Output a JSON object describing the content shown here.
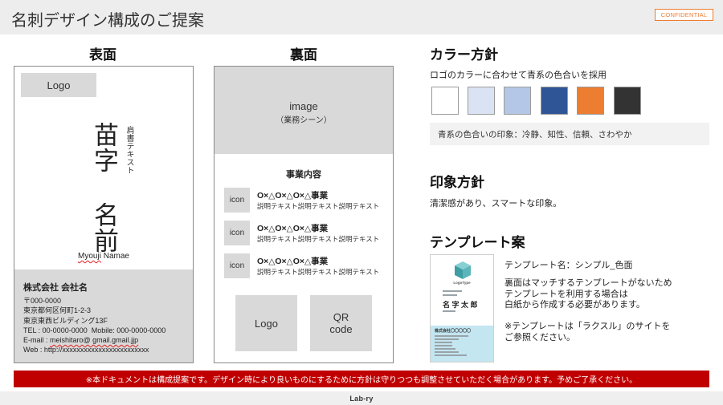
{
  "header": {
    "title": "名刺デザイン構成のご提案",
    "badge": "CONFIDENTIAL"
  },
  "front": {
    "heading": "表面",
    "logo": "Logo",
    "name": "苗字 名前",
    "job_title": "肩書テキスト",
    "romaji_first": "Myouji",
    "romaji_last": "Namae",
    "company": "株式会社 会社名",
    "postal": "〒000-0000",
    "address1": "東京都何区何町1-2-3",
    "address2": "東京東西ビルディング13F",
    "tel": "TEL : 00-0000-0000  Mobile: 000-0000-0000",
    "email_label": "E-mail : ",
    "email": "meishitaro@ gmail.gmail.jjp",
    "web": "Web : http://xxxxxxxxxxxxxxxxxxxxxxxx"
  },
  "back": {
    "heading": "裏面",
    "image_label": "image",
    "image_caption": "（業務シーン）",
    "business_heading": "事業内容",
    "items": [
      {
        "icon_label": "icon",
        "title": "O×△O×△O×△事業",
        "description": "説明テキスト説明テキスト説明テキスト"
      },
      {
        "icon_label": "icon",
        "title": "O×△O×△O×△事業",
        "description": "説明テキスト説明テキスト説明テキスト"
      },
      {
        "icon_label": "icon",
        "title": "O×△O×△O×△事業",
        "description": "説明テキスト説明テキスト説明テキスト"
      }
    ],
    "logo": "Logo",
    "qr_line1": "QR",
    "qr_line2": "code"
  },
  "color_policy": {
    "heading": "カラー方針",
    "description": "ロゴのカラーに合わせて青系の色合いを採用",
    "swatches": [
      "#ffffff",
      "#dae3f3",
      "#b4c7e7",
      "#2f5597",
      "#ed7d31",
      "#333333"
    ],
    "impression": "青系の色合いの印象：冷静、知性、信頼、さわやか"
  },
  "impression_policy": {
    "heading": "印象方針",
    "description": "清潔感があり、スマートな印象。"
  },
  "template": {
    "heading": "テンプレート案",
    "name": "テンプレート名：シンプル_色面",
    "note_lines": [
      "裏面はマッチするテンプレートがないため",
      "テンプレートを利用する場合は",
      "白紙から作成する必要があります。"
    ],
    "caution_lines": [
      "※テンプレートは「ラクスル」のサイトを",
      "ご参照ください。"
    ],
    "thumbnail": {
      "logo_icon": "cube-icon",
      "logotype": "LogoType",
      "name": "名 字 太 郎",
      "company": "株式会社〇〇〇〇〇"
    }
  },
  "footer": {
    "notice": "※本ドキュメントは構成提案です。デザイン時により良いものにするために方針は守りつつも調整させていただく場合があります。予めご了承ください。",
    "brand": "Lab-ry"
  },
  "colors": {
    "accent": "#ed7d31",
    "notice_bg": "#c00000",
    "thumbnail_band": "#c3e6f1"
  }
}
